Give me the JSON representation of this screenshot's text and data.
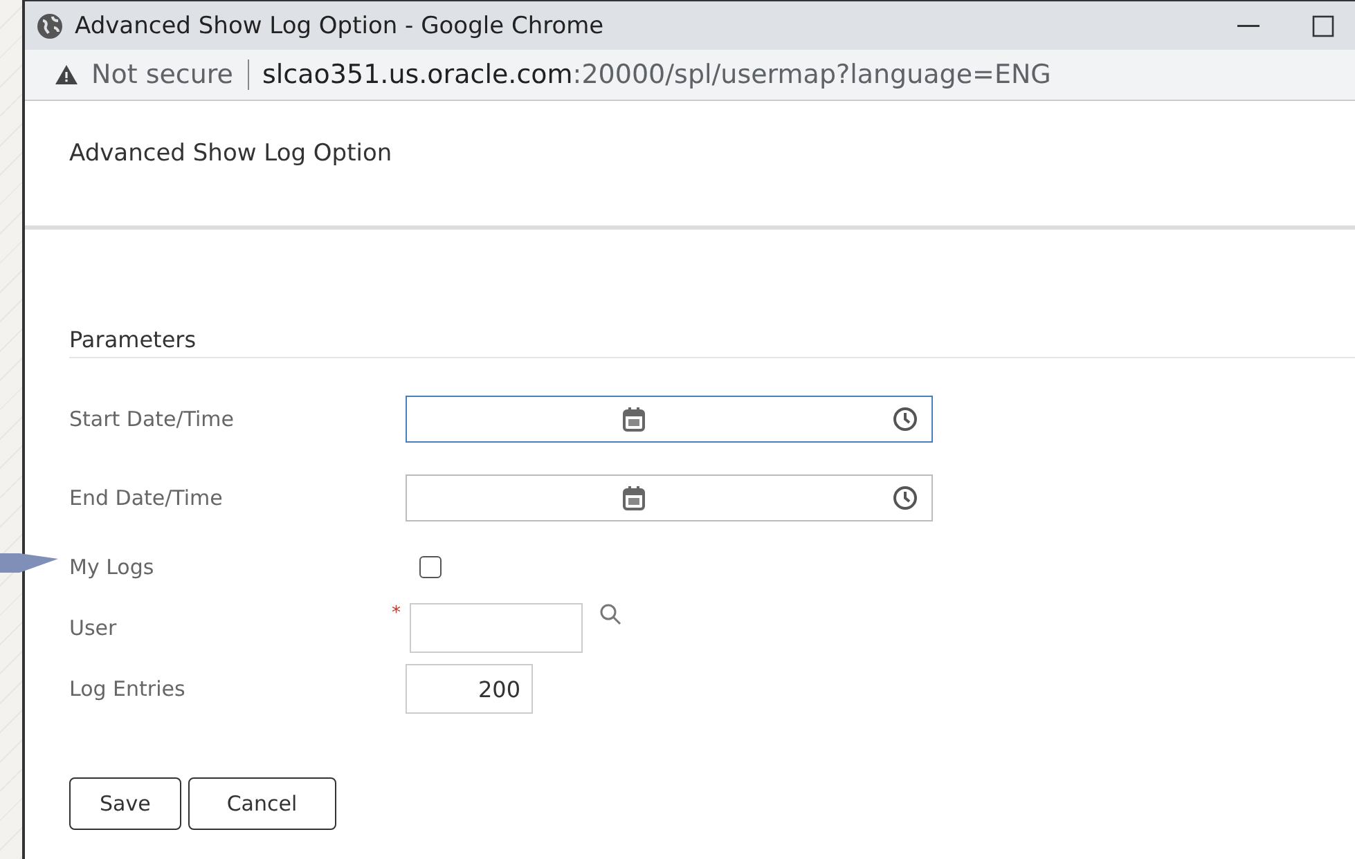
{
  "window": {
    "title": "Advanced Show Log Option - Google Chrome"
  },
  "address_bar": {
    "security": "Not secure",
    "host": "slcao351.us.oracle.com",
    "path": ":20000/spl/usermap?language=ENG"
  },
  "dialog": {
    "title": "Advanced Show Log Option",
    "section": "Parameters",
    "fields": [
      {
        "kind": "datetime",
        "label": "Start Date/Time",
        "focused": true
      },
      {
        "kind": "datetime",
        "label": "End Date/Time",
        "focused": false
      },
      {
        "kind": "checkbox",
        "label": "My Logs",
        "checked": false
      },
      {
        "kind": "lookup",
        "label": "User",
        "required": true,
        "required_marker": "*"
      },
      {
        "kind": "number",
        "label": "Log Entries",
        "value": "200"
      }
    ],
    "buttons": [
      "Save",
      "Cancel"
    ]
  }
}
